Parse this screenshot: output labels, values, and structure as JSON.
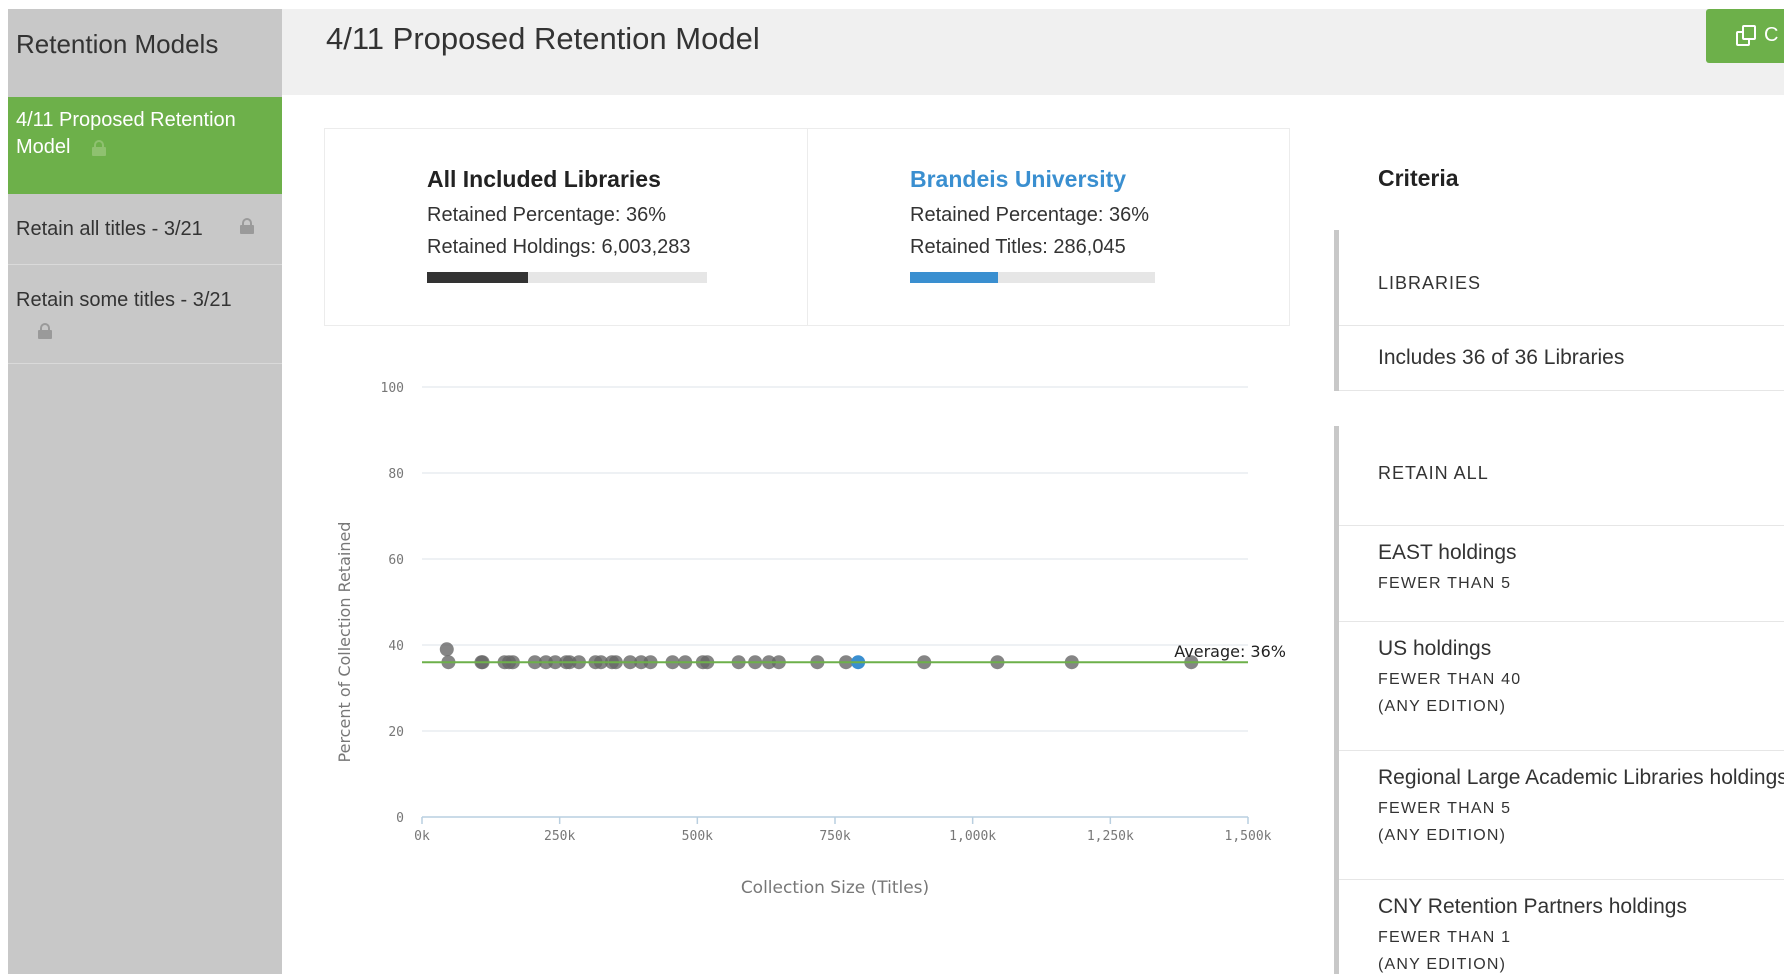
{
  "sidebar": {
    "title": "Retention Models",
    "items": [
      {
        "label": "4/11 Proposed Retention Model",
        "locked": true,
        "active": true
      },
      {
        "label": "Retain all titles - 3/21",
        "locked": true,
        "active": false
      },
      {
        "label": "Retain some titles - 3/21",
        "locked": true,
        "active": false
      }
    ]
  },
  "header": {
    "title": "4/11 Proposed Retention Model",
    "action_button": {
      "icon": "copy-icon",
      "label": "C"
    }
  },
  "stats": {
    "all": {
      "title": "All Included Libraries",
      "line1": "Retained Percentage: 36%",
      "line2": "Retained Holdings: 6,003,283",
      "progress": 0.36,
      "bar_color": "#333333"
    },
    "library": {
      "title": "Brandeis University",
      "line1": "Retained Percentage: 36%",
      "line2": "Retained Titles: 286,045",
      "progress": 0.36,
      "bar_color": "#3a8fd0"
    }
  },
  "chart_data": {
    "type": "scatter",
    "ylabel": "Percent of Collection Retained",
    "xlabel": "Collection Size (Titles)",
    "xlim": [
      0,
      1500000
    ],
    "ylim": [
      0,
      100
    ],
    "xticks": [
      "0k",
      "250k",
      "500k",
      "750k",
      "1,000k",
      "1,250k",
      "1,500k"
    ],
    "yticks": [
      "0",
      "20",
      "40",
      "60",
      "80",
      "100"
    ],
    "average": {
      "value": 36,
      "label": "Average: 36%",
      "color": "#6db04a"
    },
    "point_color": "#666666",
    "highlight_color": "#3a8fd0",
    "points": [
      [
        45000,
        39
      ],
      [
        48000,
        36
      ],
      [
        108000,
        36
      ],
      [
        110000,
        36
      ],
      [
        150000,
        36
      ],
      [
        158000,
        36
      ],
      [
        165000,
        36
      ],
      [
        205000,
        36
      ],
      [
        225000,
        36
      ],
      [
        242000,
        36
      ],
      [
        262000,
        36
      ],
      [
        268000,
        36
      ],
      [
        285000,
        36
      ],
      [
        315000,
        36
      ],
      [
        325000,
        36
      ],
      [
        345000,
        36
      ],
      [
        352000,
        36
      ],
      [
        378000,
        36
      ],
      [
        398000,
        36
      ],
      [
        415000,
        36
      ],
      [
        455000,
        36
      ],
      [
        478000,
        36
      ],
      [
        510000,
        36
      ],
      [
        518000,
        36
      ],
      [
        575000,
        36
      ],
      [
        605000,
        36
      ],
      [
        630000,
        36
      ],
      [
        648000,
        36
      ],
      [
        718000,
        36
      ],
      [
        770000,
        36
      ],
      [
        912000,
        36
      ],
      [
        1045000,
        36
      ],
      [
        1180000,
        36
      ],
      [
        1397000,
        36
      ]
    ],
    "highlight": [
      792000,
      36
    ]
  },
  "criteria": {
    "title": "Criteria",
    "libraries": {
      "heading": "LIBRARIES",
      "text": "Includes 36 of 36 Libraries"
    },
    "retain_all": {
      "heading": "RETAIN ALL",
      "rules": [
        {
          "name": "EAST holdings",
          "condition": "FEWER THAN 5",
          "qualifier": ""
        },
        {
          "name": "US holdings",
          "condition": "FEWER THAN 40",
          "qualifier": "(ANY EDITION)"
        },
        {
          "name": "Regional Large Academic Libraries holdings",
          "condition": "FEWER THAN 5",
          "qualifier": "(ANY EDITION)"
        },
        {
          "name": "CNY Retention Partners holdings",
          "condition": "FEWER THAN 1",
          "qualifier": "(ANY EDITION)"
        }
      ]
    }
  }
}
